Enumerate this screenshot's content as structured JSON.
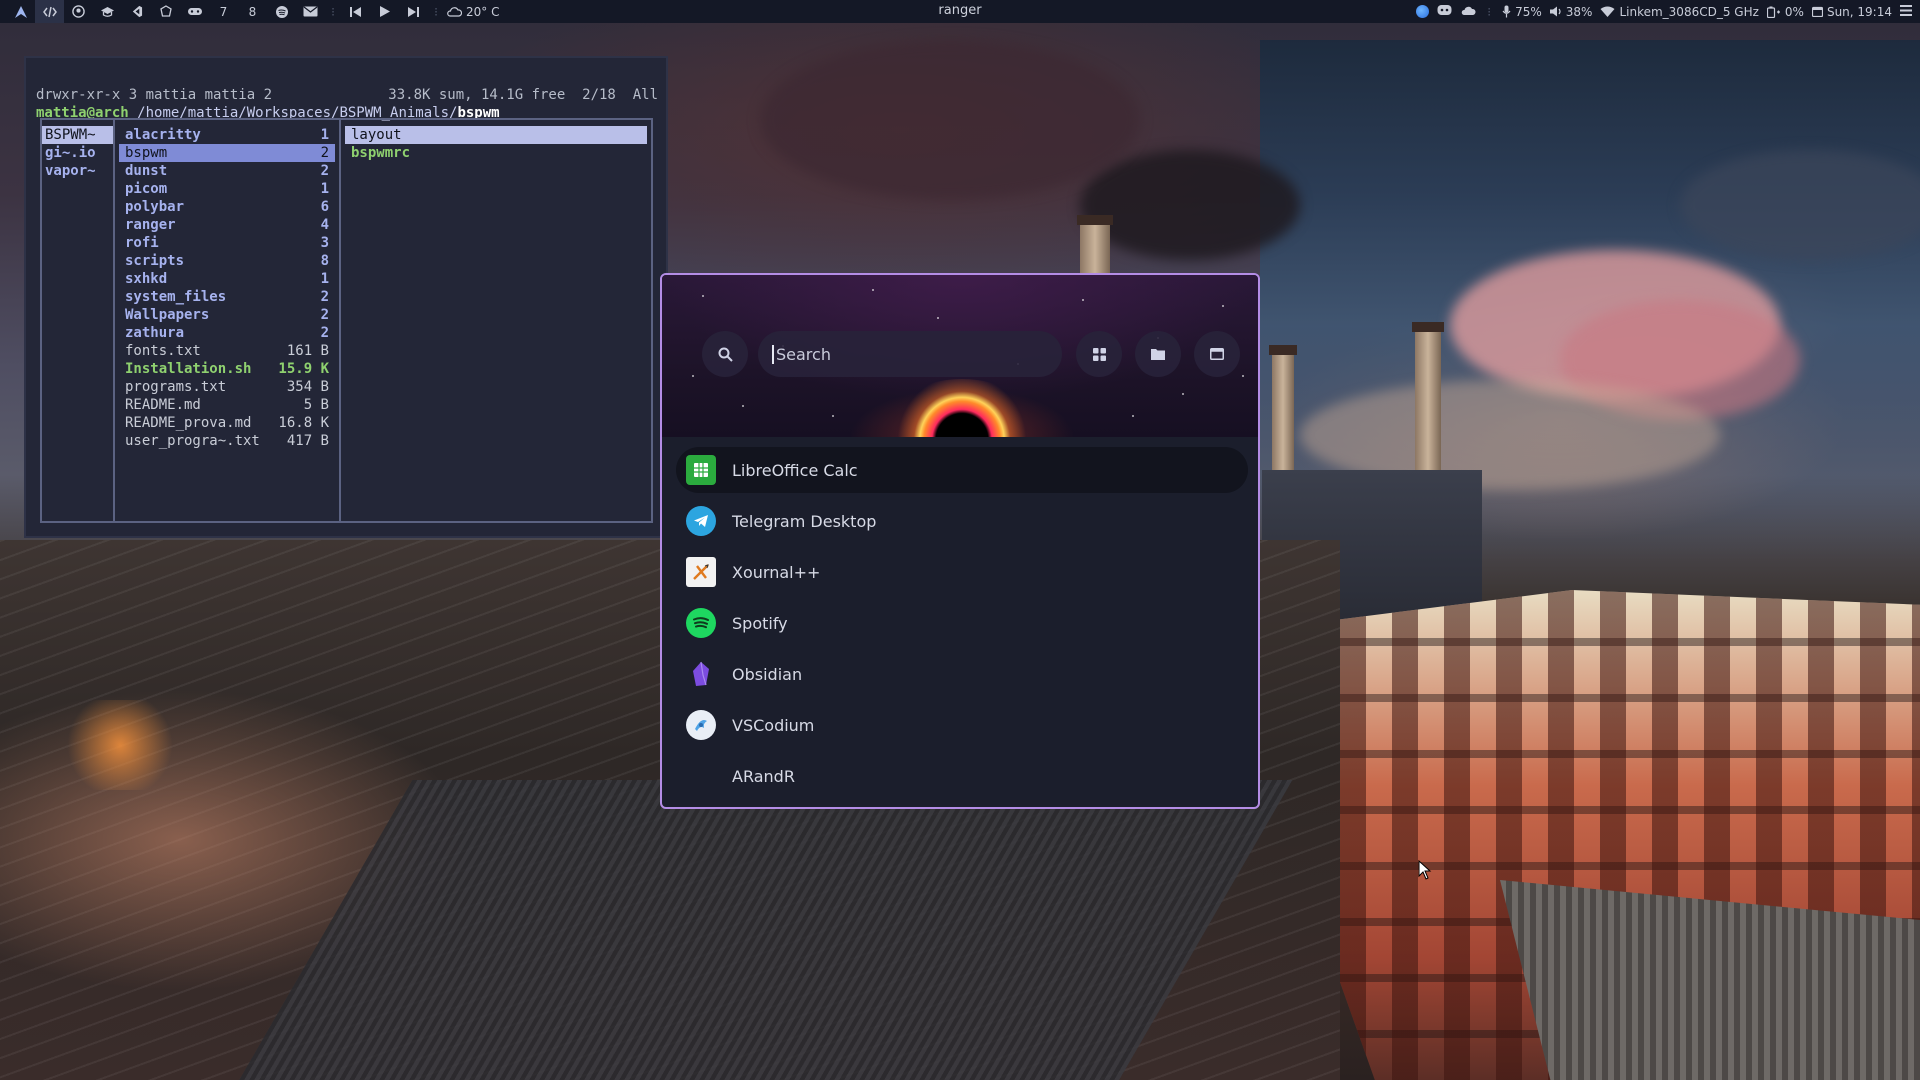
{
  "topbar": {
    "workspace_7": "7",
    "workspace_8": "8",
    "weather": "20° C",
    "window_title": "ranger",
    "mic_volume": "75%",
    "speaker_volume": "38%",
    "wifi_network": "Linkem_3086CD_5 GHz",
    "battery": "0%",
    "clock": "Sun, 19:14"
  },
  "terminal": {
    "user_host": "mattia@arch",
    "path": "/home/mattia/Workspaces/BSPWM_Animals/",
    "current_dir": "bspwm",
    "permissions": "drwxr-xr-x 3 mattia mattia 2",
    "stats": "33.8K sum, 14.1G free  2/18  All",
    "parent_entries": [
      {
        "name": "BSPWM~",
        "selected": true
      },
      {
        "name": "gi~.io",
        "selected": false
      },
      {
        "name": "vapor~",
        "selected": false
      }
    ],
    "entries": [
      {
        "name": "alacritty",
        "info": "1",
        "kind": "dir"
      },
      {
        "name": "bspwm",
        "info": "2",
        "kind": "dir",
        "selected": true
      },
      {
        "name": "dunst",
        "info": "2",
        "kind": "dir"
      },
      {
        "name": "picom",
        "info": "1",
        "kind": "dir"
      },
      {
        "name": "polybar",
        "info": "6",
        "kind": "dir"
      },
      {
        "name": "ranger",
        "info": "4",
        "kind": "dir"
      },
      {
        "name": "rofi",
        "info": "3",
        "kind": "dir"
      },
      {
        "name": "scripts",
        "info": "8",
        "kind": "dir"
      },
      {
        "name": "sxhkd",
        "info": "1",
        "kind": "dir"
      },
      {
        "name": "system_files",
        "info": "2",
        "kind": "dir"
      },
      {
        "name": "Wallpapers",
        "info": "2",
        "kind": "dir"
      },
      {
        "name": "zathura",
        "info": "2",
        "kind": "dir"
      },
      {
        "name": "fonts.txt",
        "info": "161 B",
        "kind": "file"
      },
      {
        "name": "Installation.sh",
        "info": "15.9 K",
        "kind": "exe"
      },
      {
        "name": "programs.txt",
        "info": "354 B",
        "kind": "file"
      },
      {
        "name": "README.md",
        "info": "5 B",
        "kind": "file"
      },
      {
        "name": "README_prova.md",
        "info": "16.8 K",
        "kind": "file"
      },
      {
        "name": "user_progra~.txt",
        "info": "417 B",
        "kind": "file"
      }
    ],
    "preview_entries": [
      {
        "name": "layout",
        "kind": "dir",
        "selected": true
      },
      {
        "name": "bspwmrc",
        "kind": "exe",
        "selected": false
      }
    ]
  },
  "launcher": {
    "search_placeholder": "Search",
    "apps": [
      {
        "label": "LibreOffice Calc",
        "icon": "libreoffice-calc-icon",
        "color": "#2bab3e",
        "selected": true
      },
      {
        "label": "Telegram Desktop",
        "icon": "telegram-icon",
        "color": "#2ca5e0"
      },
      {
        "label": "Xournal++",
        "icon": "xournalpp-icon",
        "color": "#f2f2f2"
      },
      {
        "label": "Spotify",
        "icon": "spotify-icon",
        "color": "#1ed760"
      },
      {
        "label": "Obsidian",
        "icon": "obsidian-icon",
        "color": "#7c4ce0"
      },
      {
        "label": "VSCodium",
        "icon": "vscodium-icon",
        "color": "#4fa3e6"
      },
      {
        "label": "ARandR",
        "icon": "",
        "color": ""
      }
    ]
  },
  "colors": {
    "accent": "#b48de6",
    "selection": "#7f8bd6",
    "executable": "#8fd16f"
  }
}
